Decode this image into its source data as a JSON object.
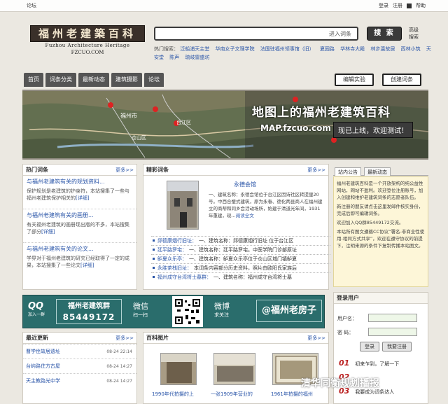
{
  "topbar": {
    "forum": "论坛",
    "login": "登录",
    "register": "注册",
    "help": "帮助"
  },
  "logo": {
    "title": "福州老建築百科",
    "en": "Fuzhou Architecture Heritage",
    "domain": "FZCUO.COM"
  },
  "search": {
    "hint": "进入词条",
    "button": "搜 索",
    "advanced": "高级搜索"
  },
  "hot_searches": {
    "label": "热门搜索：",
    "items": [
      "泛船浦天主堂",
      "华南女子文理学院",
      "法国驻福州领事馆（旧）",
      "夏园路",
      "华林寺大殿",
      "林步瀛故居",
      "西林小筑",
      "天安堂",
      "陈声",
      "琉岐雷盛坊"
    ]
  },
  "nav": {
    "tabs": [
      "首页",
      "词条分类",
      "最新动态",
      "建筑摄影",
      "论坛"
    ],
    "edit_lab": "编辑实验",
    "create": "创建词条"
  },
  "map_banner": {
    "title": "地图上的福州老建筑百科",
    "url": "MAP.fzcuo.com",
    "online": "现已上线，欢迎测试！",
    "place1": "福州市",
    "place2": "仓山区",
    "place3": "台江区"
  },
  "hot_entries": {
    "header": "热门词条",
    "more": "更多>>",
    "items": [
      {
        "title": "与福州老建筑有关的规划资料...",
        "desc": "保护规划是老建筑的护身符，本站搜集了一些与福州老建筑保护相关的",
        "link": "[详细]"
      },
      {
        "title": "与福州老建筑有关的画册...",
        "desc": "有关福州老建筑的画册现出版的不多，本站搜集了部分",
        "link": "[详细]"
      },
      {
        "title": "与福州老建筑有关的论文...",
        "desc": "学界对于福州老建筑的研究已经取得了一定的成果，本站搜集了一些论文",
        "link": "[详细]"
      }
    ]
  },
  "featured": {
    "header": "精彩词条",
    "more": "更多>>",
    "title": "永德会馆",
    "desc": "一、建筑名称：永德会馆位于台江区因诗社区转提里20号。中西合璧式建筑，原为永春、德化两县商人在福州建立的商帮和同乡会活动场所，始建于清道光年间，1931年重建，现...",
    "read_more": "阅读全文",
    "list": [
      {
        "name": "邱德康烟行旧址：",
        "text": "一、建筑名称：邱德康烟行旧址 位于台江区"
      },
      {
        "name": "廷平路罗宅：",
        "text": "一、建筑名称：廷平路罗宅。中医学院门诊部原址"
      },
      {
        "name": "鲈夏众乐亭：",
        "text": "一、建筑名称：鲈夏众乐亭位于仓山区城门镇鲈夏"
      },
      {
        "name": "永胜茶栈旧址：",
        "text": "本词条内容部分历史资料，照片由欧阳氏家族后"
      },
      {
        "name": "福州成守台湾将士墓群：",
        "text": "一、建筑名称：福州成守台湾将士墓"
      }
    ]
  },
  "announce": {
    "tabs": [
      "站内公告",
      "最新动态"
    ],
    "paras": [
      "福州老建筑百科是一个开放架构的纯公益性网站，网站不盈利。欢迎登位注册账号，加入创建和维护老建筑词条的志愿者队伍。",
      "新注册的朋友请点击这里发邮件核实身份，完成后即可编辑词条。",
      "欢迎加入QQ群85449172交流。",
      "本站所有图文遵循CC协议“署名-非商业性使用-相同方式共享”，欢迎在遵守协议的前提下，注明来源的条件下复制传播本站图文。"
    ]
  },
  "social": {
    "qq_label": "QQ",
    "qq_sub": "加入一群",
    "group_name": "福州老建筑群",
    "group_no": "85449172",
    "wechat": "微信",
    "wechat_sub": "扫一扫",
    "weibo": "微博",
    "weibo_sub": "求关注",
    "weibo_name": "@福州老房子"
  },
  "login": {
    "header": "登录用户",
    "user_label": "用户名：",
    "pass_label": "密  码：",
    "login_btn": "登录",
    "forgot_btn": "我要注册",
    "step1_no": "01",
    "step1": "初来乍到，了解一下",
    "step2_no": "02",
    "step3_no": "03",
    "step3": "我要成为词条达人"
  },
  "news": {
    "header": "最近更新",
    "more": "更多>>",
    "items": [
      {
        "name": "曹学佺故居遗址",
        "date": "08-24 22:14"
      },
      {
        "name": "台屿路住方古屋",
        "date": "08-24 14:27"
      },
      {
        "name": "天主教路光中学",
        "date": "08-24 14:27"
      }
    ]
  },
  "photos": {
    "header": "百科图片",
    "more": "更多>>",
    "caps": [
      "1990年代拍摄的上",
      "一张1909年营业的",
      "1961年拍摄的福州"
    ]
  },
  "watermark": "清华同衡规划播报",
  "colors": {
    "accent": "#2a55a8",
    "banner": "#2a6d6c",
    "notice_bg": "#fdf6d8"
  }
}
